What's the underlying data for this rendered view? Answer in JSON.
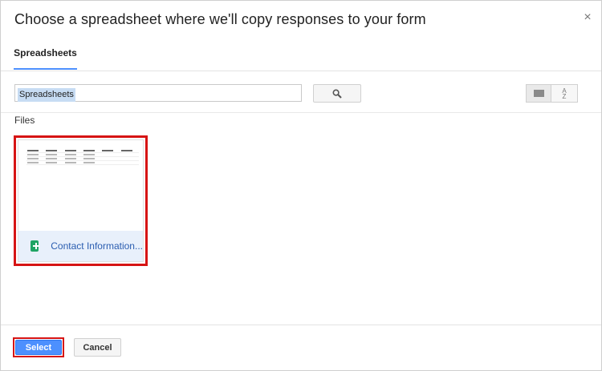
{
  "dialog": {
    "title": "Choose a spreadsheet where we'll copy responses to your form",
    "close_glyph": "×"
  },
  "tabs": [
    {
      "label": "Spreadsheets",
      "active": true
    }
  ],
  "search": {
    "chip": "Spreadsheets",
    "search_icon": "search-icon"
  },
  "view": {
    "grid_icon": "grid-view-icon",
    "sort_label_top": "A",
    "sort_label_bottom": "Z"
  },
  "files": {
    "heading": "Files",
    "items": [
      {
        "name": "Contact Information...",
        "icon": "google-sheets-icon",
        "selected": true
      }
    ]
  },
  "footer": {
    "select_label": "Select",
    "cancel_label": "Cancel"
  },
  "colors": {
    "accent": "#4d90fe",
    "highlight_border": "#d61414",
    "file_link": "#2a5db0",
    "sheets_green": "#20a464"
  }
}
